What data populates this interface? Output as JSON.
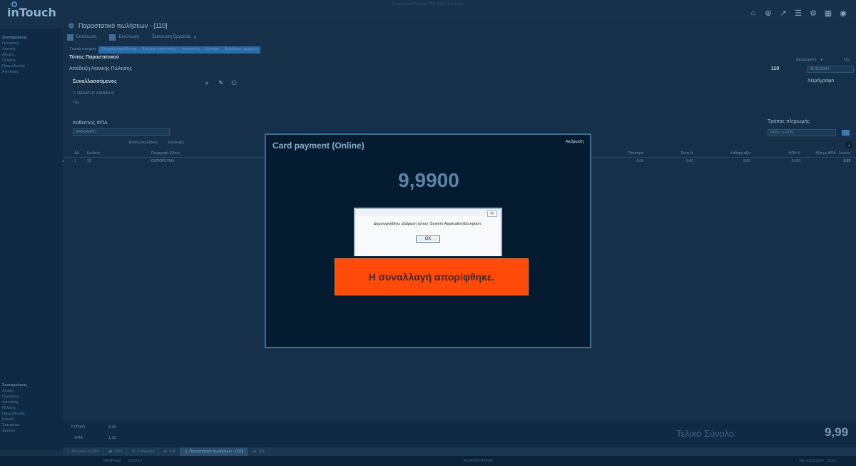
{
  "app": {
    "logo": "inTouch",
    "window_title": "Smart Retail Manager POS 2024.1.3.0 Online"
  },
  "top_icons": [
    "home-icon",
    "plus-circle-icon",
    "chart-icon",
    "filter-icon",
    "gear-icon",
    "building-icon",
    "user-circle-icon"
  ],
  "sidebar": {
    "top_items": [
      {
        "label": "Συντομεύσεις",
        "heading": true
      },
      {
        "label": "Πωλήσεις"
      },
      {
        "label": "Λιανική"
      },
      {
        "label": "Αγορές"
      },
      {
        "label": "Πελάτες"
      },
      {
        "label": "Προμηθευτές"
      },
      {
        "label": "Αποθήκη"
      }
    ],
    "bottom_items": [
      {
        "label": "Συντομεύσεις",
        "heading": true
      },
      {
        "label": "Αγορές"
      },
      {
        "label": "Πωλήσεις"
      },
      {
        "label": "Αποθήκη"
      },
      {
        "label": "Πελάτες"
      },
      {
        "label": "Προμηθευτές"
      },
      {
        "label": "Καναλί"
      },
      {
        "label": "Στατιστικά"
      },
      {
        "label": "Service"
      }
    ]
  },
  "document": {
    "title": "Παραστατικό πωλήσεων - [110]",
    "toolbar": {
      "save": "Εκτύπωση",
      "print": "Εκτύπωση",
      "extra": "Έμπνευση Εργασίας"
    },
    "tabs": [
      "Γενικά στοιχεία",
      "Στοιχεία παράδοσης",
      "Στοιχεία αποστολής",
      "Αποστολή",
      "Σύνοψη",
      "Διόρθωση αρχείων"
    ],
    "doc_type_label": "Τύπος Παραστατικού",
    "doc_type_value": "Απόδειξη Λιανικής Πώλησης",
    "doc_number": "110",
    "cancelled_label": "Ακυρωμένο",
    "no_label": "Όχι",
    "date_value": "01/11/2024",
    "handwritten_label": "Χειρόγραφο",
    "customer_label": "Συναλλασσόμενος",
    "customer_name": "2, ΠΕΛΑΤΗΣ ΛΙΑΝΙΚΗΣ",
    "customer_phone": "Τηλ",
    "vat_label": "Καθεστώς ΦΠΑ",
    "vat_value": "ΚΑΝΟΝΙΚΟ",
    "payment_label": "Τρόπος πληρωμής",
    "payment_value": "POS / e-POS",
    "grid_toolbar": {
      "add": "Έκπτωση Είδους",
      "options": "Επιλογές"
    },
    "grid_headers": [
      "ΑΑ",
      "Κωδικός",
      "Περιγραφή Είδους",
      "Ποσότητα",
      "Έκπτ.%",
      "Καθαρή αξία",
      "ΦΠΑ %",
      "Αξία με ΦΠΑ - Σύνολο"
    ],
    "grid_row": [
      "1",
      "10",
      "ΕΜΠΟΡΕΥΜΑ",
      "8,06",
      "0,00",
      "8,06",
      "24,00",
      "9,99"
    ]
  },
  "totals": {
    "net_label": "Καθαρή",
    "net_value": "8,06",
    "vat_label": "ΦΠΑ",
    "vat_value": "1,93",
    "grand_label": "Τελικό Σύνολο:",
    "grand_value": "9,99"
  },
  "taskbar": [
    {
      "label": "Κεντρική σελίδα",
      "active": false
    },
    {
      "label": "Είδη",
      "active": false
    },
    {
      "label": "Ρυθμίσεις",
      "active": false
    },
    {
      "label": "Ε/Ε",
      "active": false
    },
    {
      "label": "Παραστατικό πωλήσεων - [110]",
      "active": true
    },
    {
      "label": "Ε/Ε",
      "active": false
    }
  ],
  "statusbar": {
    "left": "SRMRetail",
    "mid": "0.2024.1",
    "center": "ADMINISTRATOR",
    "right": "Πέμ 01/11/2024 · 22:05"
  },
  "modal": {
    "title": "Card payment (Online)",
    "cancel": "Ακύρωση",
    "amount": "9,9900",
    "banner": "Η συναλλαγή απορίφθηκε."
  },
  "dialog": {
    "message": "Δημιουργήθηκε εξαίρεση τύπου 'System.ApplicationException'.",
    "ok": "OK",
    "close": "✕"
  },
  "colors": {
    "modal_bg": "#051b2f",
    "banner": "#ff4a0a",
    "page_bg": "#16324a"
  }
}
